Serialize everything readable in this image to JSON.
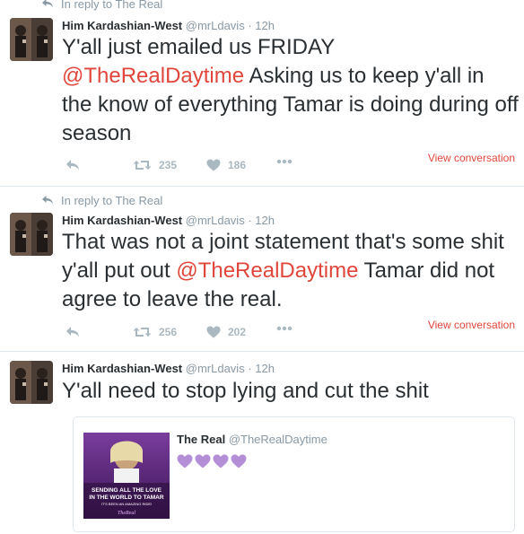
{
  "tweets": [
    {
      "reply_label": "In reply to The Real",
      "name": "Him Kardashian-West",
      "handle": "@mrLdavis",
      "time": "12h",
      "text_before": "Y'all just emailed us FRIDAY\n",
      "mention": "@TheRealDaytime",
      "text_after": " Asking us to keep y'all in the know of everything Tamar is doing during off season",
      "retweets": "235",
      "likes": "186",
      "view_conversation": "View conversation"
    },
    {
      "reply_label": "In reply to The Real",
      "name": "Him Kardashian-West",
      "handle": "@mrLdavis",
      "time": "12h",
      "text_before": "That was not a joint statement that's some shit y'all put out ",
      "mention": "@TheRealDaytime",
      "text_after": " Tamar did not agree to leave the real.",
      "retweets": "256",
      "likes": "202",
      "view_conversation": "View conversation"
    },
    {
      "name": "Him Kardashian-West",
      "handle": "@mrLdavis",
      "time": "12h",
      "text": "Y'all need to stop lying and cut the shit"
    }
  ],
  "quoted": {
    "name": "The Real",
    "handle": "@TheRealDaytime",
    "heart_count": 4,
    "heart_color": "#b48fd8",
    "image_text": {
      "line1": "SENDING ALL THE LOVE",
      "line2": "IN THE WORLD TO TAMAR",
      "line3": "IT'S BEEN AN AMAZING RIDE!",
      "logo": "TheReal",
      "logo_prefix": "The"
    }
  },
  "colors": {
    "accent": "#e0463b",
    "muted": "#8899a6",
    "divider": "#e1e8ed",
    "action": "#aab8c2"
  },
  "dot": "·"
}
